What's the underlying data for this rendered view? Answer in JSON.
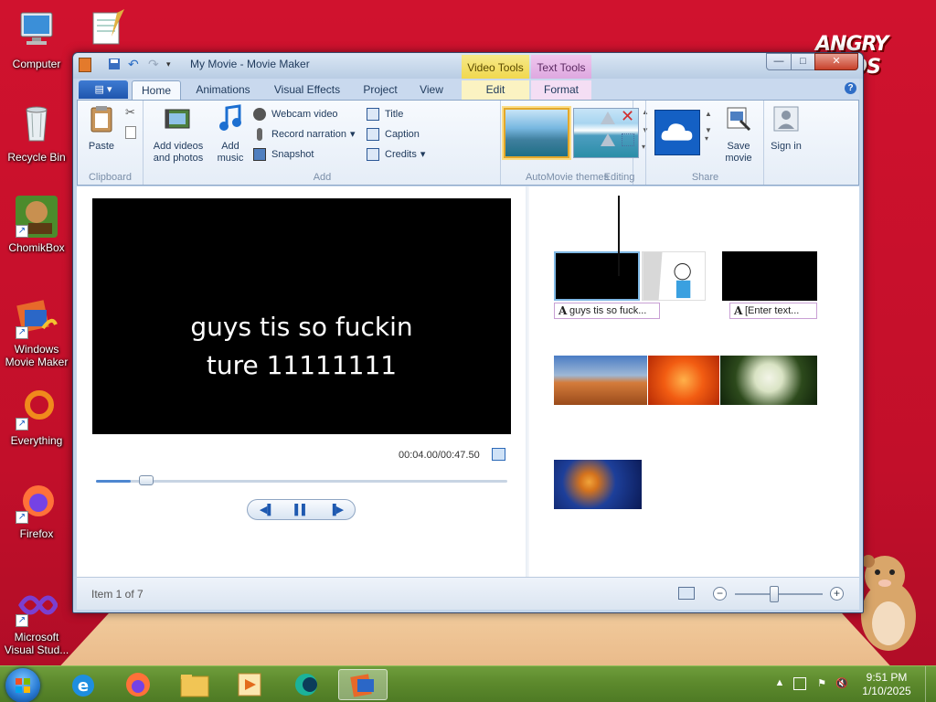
{
  "desktop": {
    "logo_text": "ANGRY BIRDS",
    "icons": [
      {
        "label": "Computer"
      },
      {
        "label": "Recycle Bin"
      },
      {
        "label": "ChomikBox"
      },
      {
        "label": "Windows Movie Maker"
      },
      {
        "label": "Everything"
      },
      {
        "label": "Firefox"
      },
      {
        "label": "Microsoft Visual Stud..."
      }
    ]
  },
  "window": {
    "title": "My Movie - Movie Maker",
    "context_tabs": {
      "video_tools": "Video Tools",
      "text_tools": "Text Tools"
    },
    "controls": {
      "minimize": "—",
      "maximize": "□",
      "close": "✕"
    },
    "ribbon_tabs": [
      "Home",
      "Animations",
      "Visual Effects",
      "Project",
      "View",
      "Edit",
      "Format"
    ],
    "active_tab": "Home",
    "help": "?",
    "app_menu": "▤ ▾"
  },
  "ribbon": {
    "clipboard": {
      "paste": "Paste",
      "group": "Clipboard"
    },
    "add": {
      "add_videos": "Add videos and photos",
      "add_music": "Add music",
      "webcam": "Webcam video",
      "narration": "Record narration",
      "snapshot": "Snapshot",
      "title": "Title",
      "caption": "Caption",
      "credits": "Credits",
      "group": "Add"
    },
    "themes": {
      "group": "AutoMovie themes"
    },
    "editing": {
      "group": "Editing"
    },
    "share": {
      "save_movie": "Save movie",
      "sign_in": "Sign in",
      "group": "Share"
    }
  },
  "preview": {
    "caption": "guys tis so fuckin\nture 11111111",
    "time": "00:04.00/00:47.50",
    "progress": 0.084
  },
  "player": {
    "prev": "◀▌",
    "pause": "▌▌",
    "next": "▐▶"
  },
  "storyboard": {
    "caption_1": "guys tis so fuck...",
    "caption_2": "[Enter text...",
    "caption_glyph": "A"
  },
  "status": {
    "text": "Item 1 of 7",
    "zoom_out": "−",
    "zoom_in": "+",
    "zoom_level": 0.45
  },
  "taskbar": {
    "time": "9:51 PM",
    "date": "1/10/2025"
  },
  "colors": {
    "accent": "#2a6cc4",
    "desktop": "#c8102e",
    "taskbar": "#5d8a2d"
  }
}
